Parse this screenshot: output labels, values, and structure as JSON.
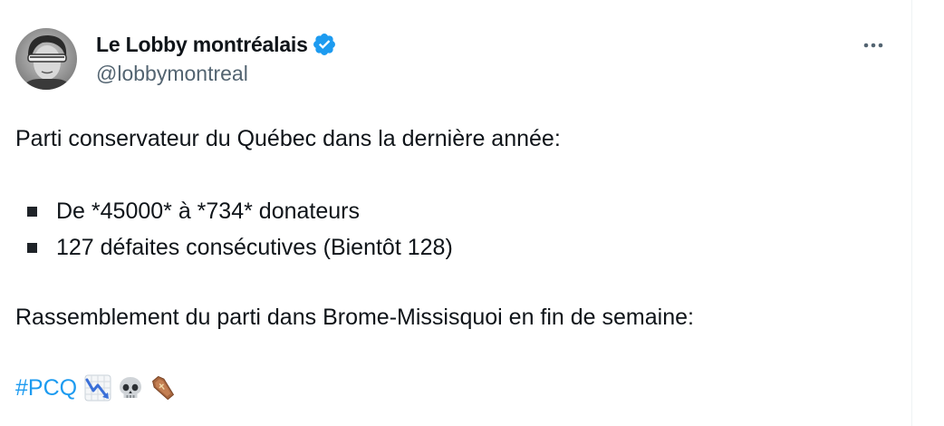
{
  "author": {
    "display_name": "Le Lobby montréalais",
    "handle": "@lobbymontreal",
    "verified": true,
    "verified_color": "#1d9bf0"
  },
  "menu": {
    "more_icon": "more-horizontal-icon"
  },
  "tweet": {
    "intro": "Parti conservateur du Québec dans la dernière année:",
    "bullets": [
      "De *45000* à *734* donateurs",
      "127 défaites consécutives (Bientôt 128)"
    ],
    "rally": "Rassemblement du parti dans Brome-Missisquoi en fin de semaine:",
    "hashtag": "#PCQ",
    "emojis": [
      "chart-decreasing-emoji",
      "skull-emoji",
      "coffin-emoji"
    ]
  },
  "colors": {
    "text": "#0f1419",
    "secondary": "#536471",
    "link": "#1d9bf0"
  }
}
